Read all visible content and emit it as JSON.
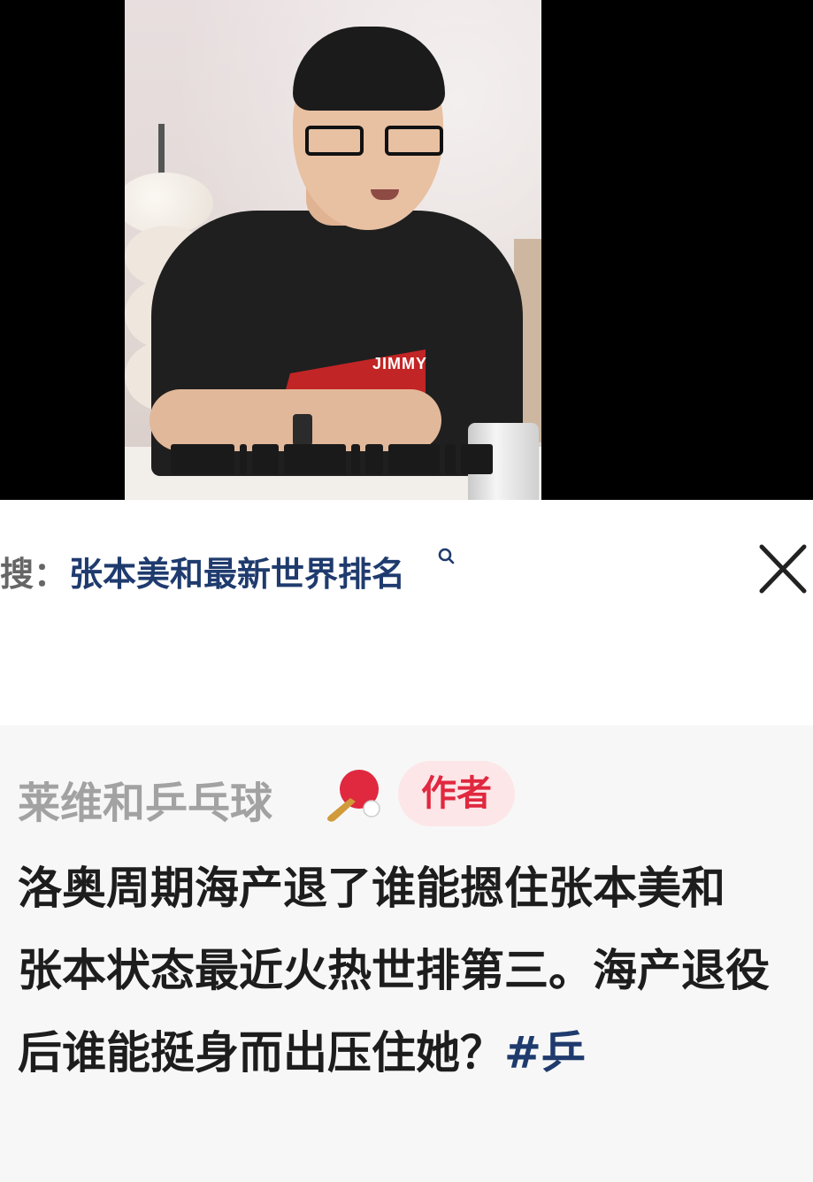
{
  "video": {
    "shirt_text": "JIMMY",
    "caption_label": ""
  },
  "search": {
    "prefix": "搜：",
    "query": "张本美和最新世界排名",
    "icon": "search-icon"
  },
  "close": {
    "icon": "close-icon"
  },
  "comment": {
    "author": "莱维和乒乓球",
    "author_emoji": "ping-pong-icon",
    "badge": "作者",
    "title_line": "洛奥周期海产退了谁能摁住张本美和",
    "body_line": "张本状态最近火热世排第三。海产退役后谁能挺身而出压住她？",
    "hashtag": "#乒"
  },
  "colors": {
    "link": "#1f3b6e",
    "badge_bg": "#fde6e8",
    "badge_text": "#e0283f",
    "author": "#a2a2a2"
  }
}
